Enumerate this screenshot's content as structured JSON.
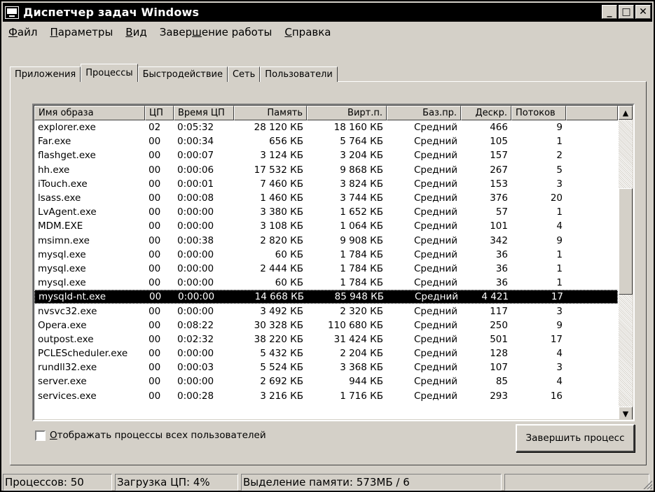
{
  "window": {
    "title": "Диспетчер задач Windows",
    "minimize": "_",
    "maximize": "□",
    "close": "✕"
  },
  "menu": [
    {
      "key": "Ф",
      "rest": "айл"
    },
    {
      "key": "П",
      "rest": "араметры"
    },
    {
      "key": "В",
      "rest": "ид"
    },
    {
      "key": "Завер",
      "rest": "шение работы",
      "underline_index": 5
    },
    {
      "key": "С",
      "rest": "правка"
    }
  ],
  "menu_labels": [
    "Файл",
    "Параметры",
    "Вид",
    "Завершение работы",
    "Справка"
  ],
  "tabs": [
    {
      "label": "Приложения",
      "active": false
    },
    {
      "label": "Процессы",
      "active": true
    },
    {
      "label": "Быстродействие",
      "active": false
    },
    {
      "label": "Сеть",
      "active": false
    },
    {
      "label": "Пользователи",
      "active": false
    }
  ],
  "columns": [
    "Имя образа",
    "ЦП",
    "Время ЦП",
    "Память",
    "Вирт.п.",
    "Баз.пр.",
    "Дескр.",
    "Потоков"
  ],
  "processes": [
    [
      "explorer.exe",
      "02",
      "0:05:32",
      "28 120 КБ",
      "18 160 КБ",
      "Средний",
      "466",
      "9"
    ],
    [
      "Far.exe",
      "00",
      "0:00:34",
      "656 КБ",
      "5 764 КБ",
      "Средний",
      "105",
      "1"
    ],
    [
      "flashget.exe",
      "00",
      "0:00:07",
      "3 124 КБ",
      "3 204 КБ",
      "Средний",
      "157",
      "2"
    ],
    [
      "hh.exe",
      "00",
      "0:00:06",
      "17 532 КБ",
      "9 868 КБ",
      "Средний",
      "267",
      "5"
    ],
    [
      "iTouch.exe",
      "00",
      "0:00:01",
      "7 460 КБ",
      "3 824 КБ",
      "Средний",
      "153",
      "3"
    ],
    [
      "lsass.exe",
      "00",
      "0:00:08",
      "1 460 КБ",
      "3 744 КБ",
      "Средний",
      "376",
      "20"
    ],
    [
      "LvAgent.exe",
      "00",
      "0:00:00",
      "3 380 КБ",
      "1 652 КБ",
      "Средний",
      "57",
      "1"
    ],
    [
      "MDM.EXE",
      "00",
      "0:00:00",
      "3 108 КБ",
      "1 064 КБ",
      "Средний",
      "101",
      "4"
    ],
    [
      "msimn.exe",
      "00",
      "0:00:38",
      "2 820 КБ",
      "9 908 КБ",
      "Средний",
      "342",
      "9"
    ],
    [
      "mysql.exe",
      "00",
      "0:00:00",
      "60 КБ",
      "1 784 КБ",
      "Средний",
      "36",
      "1"
    ],
    [
      "mysql.exe",
      "00",
      "0:00:00",
      "2 444 КБ",
      "1 784 КБ",
      "Средний",
      "36",
      "1"
    ],
    [
      "mysql.exe",
      "00",
      "0:00:00",
      "60 КБ",
      "1 784 КБ",
      "Средний",
      "36",
      "1"
    ],
    [
      "mysqld-nt.exe",
      "00",
      "0:00:00",
      "14 668 КБ",
      "85 948 КБ",
      "Средний",
      "4 421",
      "17"
    ],
    [
      "nvsvc32.exe",
      "00",
      "0:00:00",
      "3 492 КБ",
      "2 320 КБ",
      "Средний",
      "117",
      "3"
    ],
    [
      "Opera.exe",
      "00",
      "0:08:22",
      "30 328 КБ",
      "110 680 КБ",
      "Средний",
      "250",
      "9"
    ],
    [
      "outpost.exe",
      "00",
      "0:02:32",
      "38 220 КБ",
      "31 424 КБ",
      "Средний",
      "501",
      "17"
    ],
    [
      "PCLEScheduler.exe",
      "00",
      "0:00:00",
      "5 432 КБ",
      "2 204 КБ",
      "Средний",
      "128",
      "4"
    ],
    [
      "rundll32.exe",
      "00",
      "0:00:03",
      "5 524 КБ",
      "3 368 КБ",
      "Средний",
      "107",
      "3"
    ],
    [
      "server.exe",
      "00",
      "0:00:00",
      "2 692 КБ",
      "944 КБ",
      "Средний",
      "85",
      "4"
    ],
    [
      "services.exe",
      "00",
      "0:00:28",
      "3 216 КБ",
      "1 716 КБ",
      "Средний",
      "293",
      "16"
    ]
  ],
  "selected_process": "mysqld-nt.exe",
  "show_all_label": "Отображать процессы всех пользователей",
  "show_all_checked": false,
  "end_process_label": "Завершить процесс",
  "status": {
    "processes": "Процессов: 50",
    "cpu": "Загрузка ЦП: 4%",
    "memory": "Выделение памяти: 573МБ / 6"
  },
  "icons": {
    "app": "task-manager-icon",
    "scroll_up": "▲",
    "scroll_down": "▼"
  }
}
